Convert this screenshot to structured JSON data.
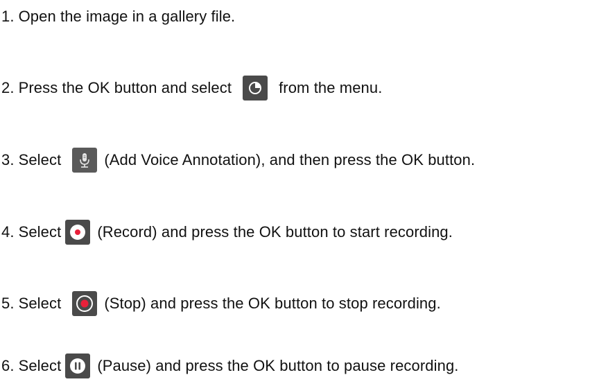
{
  "steps": [
    {
      "number": "1.",
      "text": "Open the image in a gallery file."
    },
    {
      "number": "2.",
      "before": "Press the OK button and select",
      "icon": "pie-chart-icon",
      "after": "from the menu."
    },
    {
      "number": "3.",
      "before": "Select",
      "icon": "microphone-icon",
      "after": "(Add Voice Annotation), and then press the OK button."
    },
    {
      "number": "4.",
      "before": "Select",
      "icon": "record-icon",
      "after": "(Record) and press the OK button to start recording."
    },
    {
      "number": "5.",
      "before": "Select",
      "icon": "stop-icon",
      "after": "(Stop) and press the OK button to stop recording."
    },
    {
      "number": "6.",
      "before": "Select",
      "icon": "pause-icon",
      "after": "(Pause) and press the OK button to pause recording."
    }
  ],
  "colors": {
    "icon_background": "#4a4a4a",
    "icon_foreground": "#ffffff",
    "record_red": "#e8203a"
  }
}
